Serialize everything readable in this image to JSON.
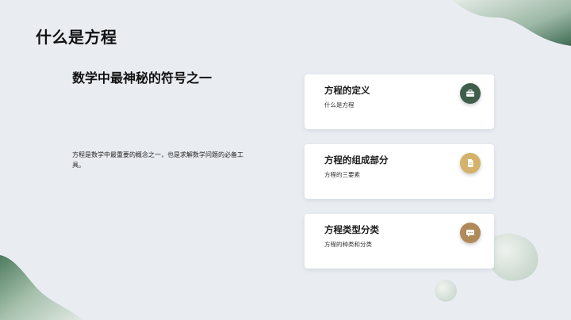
{
  "slide": {
    "title": "什么是方程",
    "subtitle": "数学中最神秘的符号之一",
    "description": "方程是数学中最重要的概念之一，也是求解数学问题的必备工具。"
  },
  "cards": [
    {
      "title": "方程的定义",
      "desc": "什么是方程",
      "icon": "briefcase-icon",
      "icon_color": "#3f5e4c"
    },
    {
      "title": "方程的组成部分",
      "desc": "方程的三要素",
      "icon": "document-icon",
      "icon_color": "#d5b26b"
    },
    {
      "title": "方程类型分类",
      "desc": "方程的种类和分类",
      "icon": "chat-bubble-icon",
      "icon_color": "#b08a58"
    }
  ]
}
